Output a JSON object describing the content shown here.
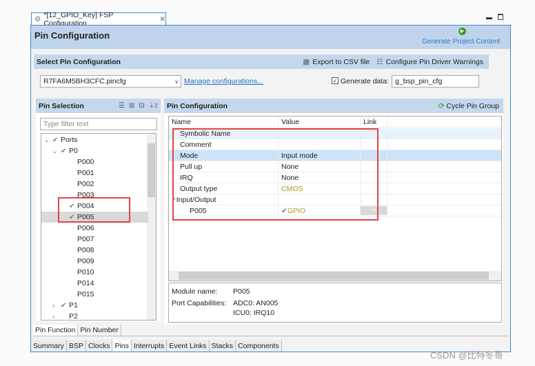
{
  "tab": {
    "title": "*[12_GPIO_Key] FSP Configuration",
    "icon": "gear-icon"
  },
  "header": {
    "title": "Pin Configuration",
    "generate": "Generate Project Content"
  },
  "select": {
    "title": "Select Pin Configuration",
    "export": "Export to CSV file",
    "warnings": "Configure Pin Driver Warnings",
    "config_value": "R7FA6M5BH3CFC.pincfg",
    "manage": "Manage configurations...",
    "generate_label": "Generate data:",
    "generate_checked": true,
    "generate_value": "g_bsp_pin_cfg"
  },
  "pin_selection": {
    "title": "Pin Selection",
    "filter_placeholder": "Type filter text",
    "tree": [
      {
        "label": "Ports",
        "level": 0,
        "expanded": true,
        "check": true
      },
      {
        "label": "P0",
        "level": 1,
        "expanded": true,
        "check": true
      },
      {
        "label": "P000",
        "level": 2,
        "check": false
      },
      {
        "label": "P001",
        "level": 2,
        "check": false
      },
      {
        "label": "P002",
        "level": 2,
        "check": false
      },
      {
        "label": "P003",
        "level": 2,
        "check": false
      },
      {
        "label": "P004",
        "level": 2,
        "check": true
      },
      {
        "label": "P005",
        "level": 2,
        "check": true,
        "selected": true
      },
      {
        "label": "P006",
        "level": 2,
        "check": false
      },
      {
        "label": "P007",
        "level": 2,
        "check": false
      },
      {
        "label": "P008",
        "level": 2,
        "check": false
      },
      {
        "label": "P009",
        "level": 2,
        "check": false
      },
      {
        "label": "P010",
        "level": 2,
        "check": false
      },
      {
        "label": "P014",
        "level": 2,
        "check": false
      },
      {
        "label": "P015",
        "level": 2,
        "check": false
      },
      {
        "label": "P1",
        "level": 1,
        "expanded": false,
        "check": true
      },
      {
        "label": "P2",
        "level": 1,
        "expanded": false,
        "check": false
      }
    ]
  },
  "pin_config": {
    "title": "Pin Configuration",
    "cycle": "Cycle Pin Group",
    "columns": [
      "Name",
      "Value",
      "Link"
    ],
    "rows": [
      {
        "name": "Symbolic Name",
        "value": "",
        "hl": "light"
      },
      {
        "name": "Comment",
        "value": ""
      },
      {
        "name": "Mode",
        "value": "Input mode",
        "hl": "strong"
      },
      {
        "name": "Pull up",
        "value": "None"
      },
      {
        "name": "IRQ",
        "value": "None"
      },
      {
        "name": "Output type",
        "value": "CMOS",
        "color": "#a89a2a"
      },
      {
        "name": "Input/Output",
        "value": "",
        "group": true
      },
      {
        "name": "P005",
        "value": "GPIO",
        "color": "#a89a2a",
        "check": true,
        "indent": true,
        "link": true
      }
    ],
    "module_label": "Module name:",
    "module_value": "P005",
    "caps_label": "Port Capabilities:",
    "caps": [
      "ADC0: AN005",
      "ICU0: IRQ10"
    ]
  },
  "side_tabs": [
    "Pin Function",
    "Pin Number"
  ],
  "bottom_tabs": [
    "Summary",
    "BSP",
    "Clocks",
    "Pins",
    "Interrupts",
    "Event Links",
    "Stacks",
    "Components"
  ],
  "active_bottom": "Pins",
  "watermark": "CSDN @比特冬哥"
}
